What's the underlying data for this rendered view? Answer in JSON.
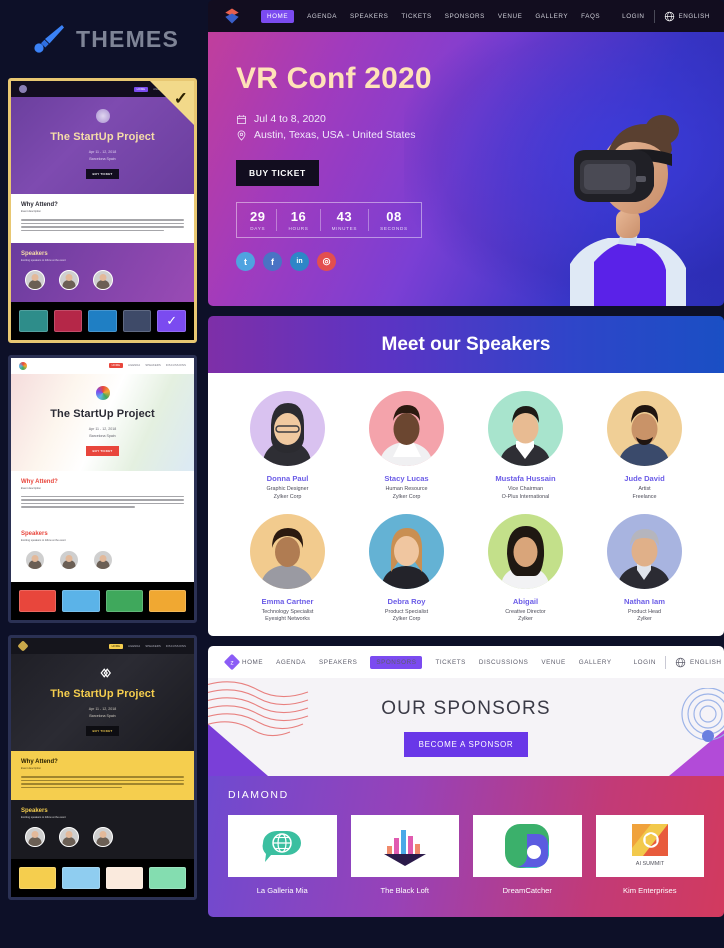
{
  "left_panel": {
    "header": {
      "title": "THEMES",
      "icon": "paintbrush-icon"
    },
    "themes": [
      {
        "id": "theme-purple",
        "selected": true,
        "nav": {
          "logo": "globe-icon",
          "links": [
            "HOME",
            "AGENDA",
            "SPEAKERS"
          ],
          "active": "HOME"
        },
        "hero_title": "The StartUp Project",
        "hero_date": "Apr 11 - 12, 2018",
        "hero_location": "Barcelona Spain",
        "hero_button": "BUY TICKET",
        "section_title": "Why Attend?",
        "section_subtitle": "Event description",
        "speakers_title": "Speakers",
        "speakers_subtitle": "Exciting speakers to follow at the event",
        "swatches": [
          "#2e8d8a",
          "#b52748",
          "#1f7fc4",
          "#3e4a68",
          "#7b4bf0"
        ],
        "selected_swatch": 4
      },
      {
        "id": "theme-light",
        "selected": false,
        "nav": {
          "logo": "color-wheel-icon",
          "links": [
            "HOME",
            "AGENDA",
            "SPEAKERS",
            "DISCUSSIONS"
          ],
          "active": "HOME"
        },
        "hero_title": "The StartUp Project",
        "hero_date": "Apr 11 - 12, 2018",
        "hero_location": "Barcelona Spain",
        "hero_button": "BUY TICKET",
        "section_title": "Why Attend?",
        "section_subtitle": "Event description",
        "speakers_title": "Speakers",
        "speakers_subtitle": "Exciting speakers to follow at the event",
        "swatches": [
          "#e8463c",
          "#5bb3e8",
          "#3fa85c",
          "#f0a832"
        ],
        "selected_swatch": -1
      },
      {
        "id": "theme-dark-gold",
        "selected": false,
        "nav": {
          "logo": "diamond-icon",
          "links": [
            "HOME",
            "AGENDA",
            "SPEAKERS",
            "DISCUSSIONS"
          ],
          "active": "HOME"
        },
        "hero_title": "The StartUp Project",
        "hero_date": "Apr 11 - 12, 2018",
        "hero_location": "Barcelona Spain",
        "hero_button": "BUY TICKET",
        "section_title": "Why Attend?",
        "section_subtitle": "Event description",
        "speakers_title": "Speakers",
        "speakers_subtitle": "Exciting speakers to follow at the event",
        "swatches": [
          "#f5ce4e",
          "#8fcdf0",
          "#faeadd",
          "#84ddb0"
        ],
        "selected_swatch": -1
      }
    ]
  },
  "hero_preview": {
    "nav": {
      "logo": "chevron-logo-icon",
      "links": [
        "HOME",
        "AGENDA",
        "SPEAKERS",
        "TICKETS",
        "SPONSORS",
        "VENUE",
        "GALLERY",
        "FAQS"
      ],
      "active": "HOME",
      "login": "LOGIN",
      "language": "ENGLISH",
      "language_icon": "globe-icon"
    },
    "title": "VR Conf 2020",
    "date_icon": "calendar-icon",
    "date": "Jul 4 to 8, 2020",
    "location_icon": "map-pin-icon",
    "location": "Austin, Texas, USA - United States",
    "cta": "BUY TICKET",
    "countdown": [
      {
        "value": "29",
        "label": "DAYS"
      },
      {
        "value": "16",
        "label": "HOURS"
      },
      {
        "value": "43",
        "label": "MINUTES"
      },
      {
        "value": "08",
        "label": "SECONDS"
      }
    ],
    "socials": [
      {
        "name": "twitter-icon",
        "glyph": "t",
        "color": "#4fa3e0"
      },
      {
        "name": "facebook-icon",
        "glyph": "f",
        "color": "#4a73c4"
      },
      {
        "name": "linkedin-icon",
        "glyph": "in",
        "color": "#2e86c7"
      },
      {
        "name": "instagram-icon",
        "glyph": "◎",
        "color": "#e34f4f"
      }
    ]
  },
  "speakers_preview": {
    "heading": "Meet our Speakers",
    "speakers": [
      {
        "name": "Donna Paul",
        "role": "Graphic Designer",
        "org": "Zylker Corp",
        "bg": "#d9c2f0"
      },
      {
        "name": "Stacy Lucas",
        "role": "Human Resource",
        "org": "Zylker Corp",
        "bg": "#f4a3ab"
      },
      {
        "name": "Mustafa Hussain",
        "role": "Vice Chairman",
        "org": "O-Plus International",
        "bg": "#a8e4cd"
      },
      {
        "name": "Jude David",
        "role": "Artist",
        "org": "Freelance",
        "bg": "#f0cf96"
      },
      {
        "name": "Emma Cartner",
        "role": "Technology Specialist",
        "org": "Eyesight Networks",
        "bg": "#f2cb8e"
      },
      {
        "name": "Debra Roy",
        "role": "Product Specialist",
        "org": "Zylker Corp",
        "bg": "#64b2d4"
      },
      {
        "name": "Abigail",
        "role": "Creative Director",
        "org": "Zylker",
        "bg": "#c3e08a"
      },
      {
        "name": "Nathan Iam",
        "role": "Product Head",
        "org": "Zylker",
        "bg": "#a8b4e0"
      }
    ]
  },
  "sponsors_preview": {
    "nav": {
      "logo": "diamond-logo-icon",
      "links": [
        "HOME",
        "AGENDA",
        "SPEAKERS",
        "SPONSORS",
        "TICKETS",
        "DISCUSSIONS",
        "VENUE",
        "GALLERY"
      ],
      "active": "SPONSORS",
      "login": "LOGIN",
      "language": "ENGLISH",
      "language_icon": "globe-icon"
    },
    "heading": "OUR SPONSORS",
    "cta": "BECOME A SPONSOR",
    "tier": "DIAMOND",
    "sponsors": [
      {
        "name": "La Galleria Mia",
        "logo": "globe-chat-icon"
      },
      {
        "name": "The Black Loft",
        "logo": "bar-chart-arrow-icon"
      },
      {
        "name": "DreamCatcher",
        "logo": "rounded-square-icon"
      },
      {
        "name": "Kim Enterprises",
        "logo": "ai-summit-icon",
        "logo_text": "AI SUMMIT"
      }
    ]
  }
}
